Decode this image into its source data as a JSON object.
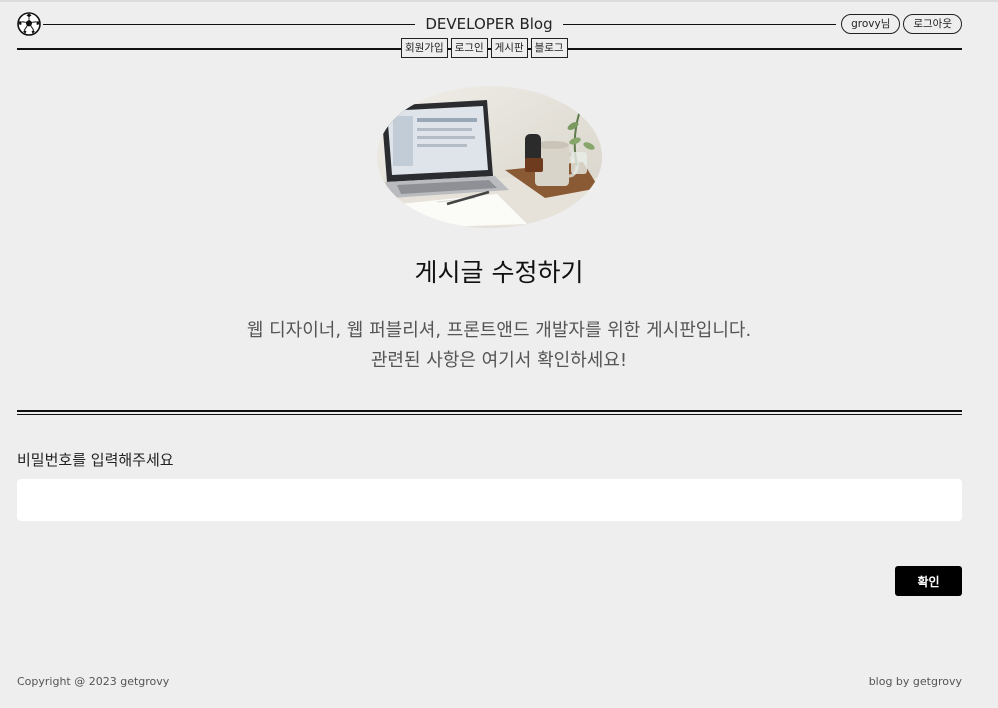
{
  "header": {
    "site_title": "DEVELOPER Blog",
    "logo_icon": "soccer-ball-icon",
    "user": {
      "greeting": "grovy님",
      "logout_label": "로그아웃"
    },
    "nav": [
      {
        "label": "회원가입"
      },
      {
        "label": "로그인"
      },
      {
        "label": "게시판"
      },
      {
        "label": "블로그"
      }
    ]
  },
  "hero": {
    "image_icon": "laptop-desk-photo",
    "title": "게시글 수정하기",
    "description_line1": "웹 디자이너, 웹 퍼블리셔, 프론트앤드 개발자를 위한 게시판입니다.",
    "description_line2": "관련된 사항은 여기서 확인하세요!"
  },
  "form": {
    "password_label": "비밀번호를 입력해주세요",
    "password_value": "",
    "password_placeholder": "",
    "confirm_label": "확인"
  },
  "footer": {
    "copyright": "Copyright @ 2023 getgrovy",
    "credit": "blog by getgrovy"
  }
}
